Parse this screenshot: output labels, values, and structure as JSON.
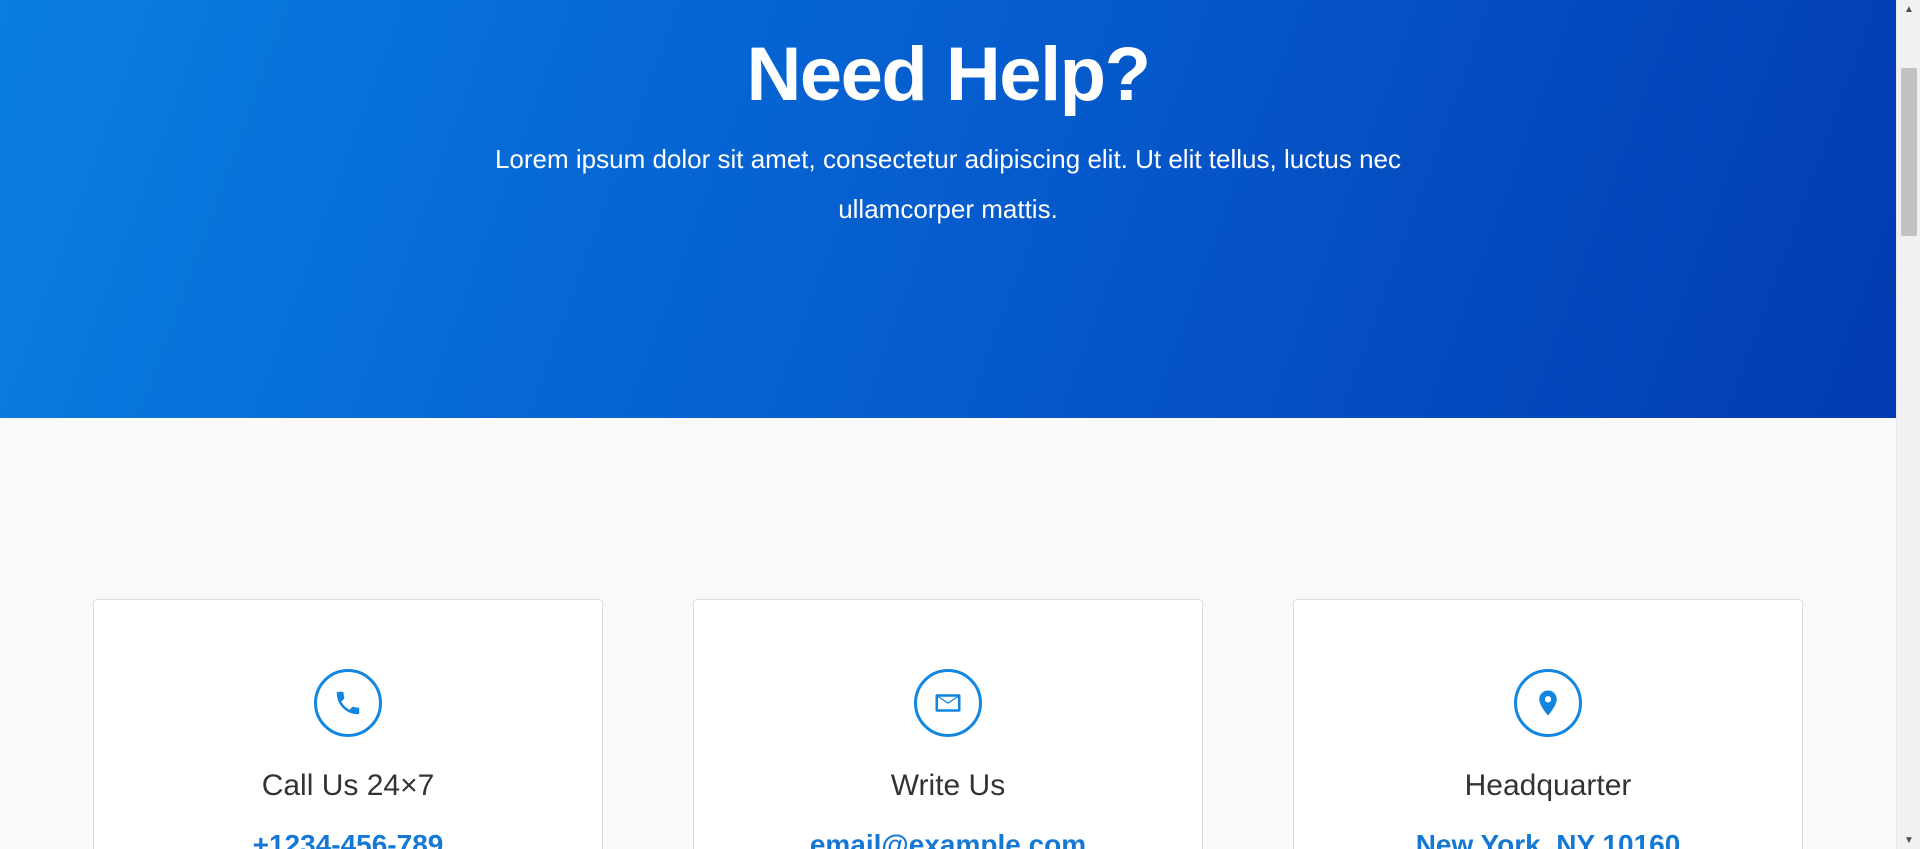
{
  "hero": {
    "title": "Need Help?",
    "text": "Lorem ipsum dolor sit amet, consectetur adipiscing elit. Ut elit tellus, luctus nec ullamcorper mattis."
  },
  "cards": [
    {
      "icon": "phone-icon",
      "title": "Call Us 24×7",
      "link": "+1234-456-789"
    },
    {
      "icon": "envelope-icon",
      "title": "Write Us",
      "link": "email@example.com"
    },
    {
      "icon": "location-pin-icon",
      "title": "Headquarter",
      "link": "New York, NY 10160"
    }
  ],
  "colors": {
    "hero_gradient_start": "#0a7fe0",
    "hero_gradient_end": "#023bb1",
    "accent": "#1186e0",
    "link": "#1578d4",
    "page_background": "#f9f9f9"
  },
  "scrollbar": {
    "up_arrow": "▲",
    "down_arrow": "▼"
  }
}
